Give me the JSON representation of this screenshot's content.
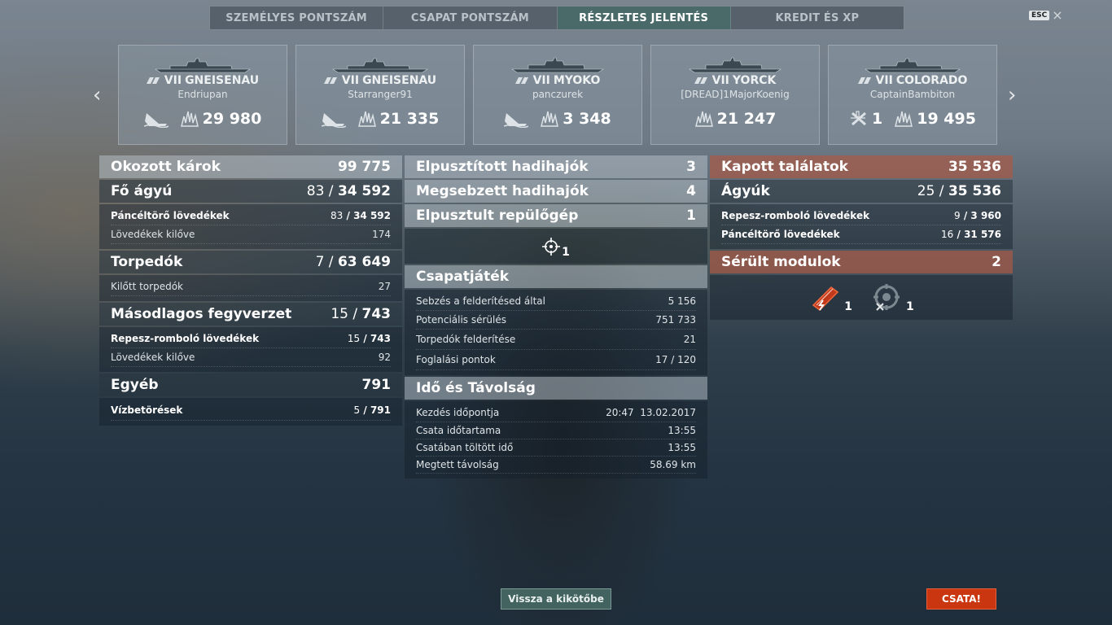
{
  "tabs": [
    {
      "label": "SZEMÉLYES PONTSZÁM",
      "active": false
    },
    {
      "label": "CSAPAT PONTSZÁM",
      "active": false
    },
    {
      "label": "RÉSZLETES JELENTÉS",
      "active": true
    },
    {
      "label": "KREDIT ÉS XP",
      "active": false
    }
  ],
  "esc": {
    "key": "ESC",
    "close": "×"
  },
  "nav": {
    "prev": "‹",
    "next": "›"
  },
  "cards": [
    {
      "tier": "VII",
      "ship": "GNEISENAU",
      "player": "Endriupan",
      "stat1": "",
      "stat2": "29 980"
    },
    {
      "tier": "VII",
      "ship": "GNEISENAU",
      "player": "Starranger91",
      "stat1": "",
      "stat2": "21 335"
    },
    {
      "tier": "VII",
      "ship": "MYOKO",
      "player": "panczurek",
      "stat1": "",
      "stat2": "3 348"
    },
    {
      "tier": "VII",
      "ship": "YORCK",
      "player": "[DREAD]1MajorKoenig",
      "stat1": "",
      "stat2": "21 247"
    },
    {
      "tier": "VII",
      "ship": "COLORADO",
      "player": "CaptainBambiton",
      "stat1": "1",
      "stat2": "19 495"
    }
  ],
  "left": {
    "damage": {
      "label": "Okozott károk",
      "value": "99 775"
    },
    "main": {
      "label": "Fő ágyú",
      "a": "83",
      "b": "34 592"
    },
    "main_rows": [
      {
        "label": "Páncéltörő lövedékek",
        "a": "83",
        "b": "34 592"
      },
      {
        "label": "Lövedékek kilőve",
        "value": "174"
      }
    ],
    "torp": {
      "label": "Torpedók",
      "a": "7",
      "b": "63 649"
    },
    "torp_rows": [
      {
        "label": "Kilőtt torpedók",
        "value": "27"
      }
    ],
    "sec": {
      "label": "Másodlagos fegyverzet",
      "a": "15",
      "b": "743"
    },
    "sec_rows": [
      {
        "label": "Repesz-romboló lövedékek",
        "a": "15",
        "b": "743"
      },
      {
        "label": "Lövedékek kilőve",
        "value": "92"
      }
    ],
    "other": {
      "label": "Egyéb",
      "value": "791"
    },
    "other_rows": [
      {
        "label": "Vízbetörések",
        "a": "5",
        "b": "791"
      }
    ]
  },
  "middle": {
    "destroyed": {
      "label": "Elpusztított hadihajók",
      "value": "3"
    },
    "damaged": {
      "label": "Megsebzett hadihajók",
      "value": "4"
    },
    "planes": {
      "label": "Elpusztult repülőgép",
      "value": "1"
    },
    "planes_icon_count": "1",
    "team": {
      "label": "Csapatjáték"
    },
    "team_rows": [
      {
        "label": "Sebzés a felderítésed által",
        "value": "5 156"
      },
      {
        "label": "Potenciális sérülés",
        "value": "751 733"
      },
      {
        "label": "Torpedók felderítése",
        "value": "21"
      },
      {
        "label": "Foglalási pontok",
        "value": "17 / 120"
      }
    ],
    "time": {
      "label": "Idő és Távolság"
    },
    "time_rows": [
      {
        "label": "Kezdés időpontja",
        "value": "20:47  13.02.2017"
      },
      {
        "label": "Csata időtartama",
        "value": "13:55"
      },
      {
        "label": "Csatában töltött idő",
        "value": "13:55"
      },
      {
        "label": "Megtett távolság",
        "value": "58.69 km"
      }
    ]
  },
  "right": {
    "received": {
      "label": "Kapott találatok",
      "value": "35 536"
    },
    "guns": {
      "label": "Ágyúk",
      "a": "25",
      "b": "35 536"
    },
    "guns_rows": [
      {
        "label": "Repesz-romboló lövedékek",
        "a": "9",
        "b": "3 960"
      },
      {
        "label": "Páncéltörő lövedékek",
        "a": "16",
        "b": "31 576"
      }
    ],
    "modules": {
      "label": "Sérült modulok",
      "value": "2"
    },
    "module_icons": [
      {
        "icon": "engine-damaged-icon",
        "count": "1"
      },
      {
        "icon": "rudder-damaged-icon",
        "count": "1"
      }
    ]
  },
  "buttons": {
    "port": "Vissza a kikötőbe",
    "battle": "CSATA!"
  }
}
